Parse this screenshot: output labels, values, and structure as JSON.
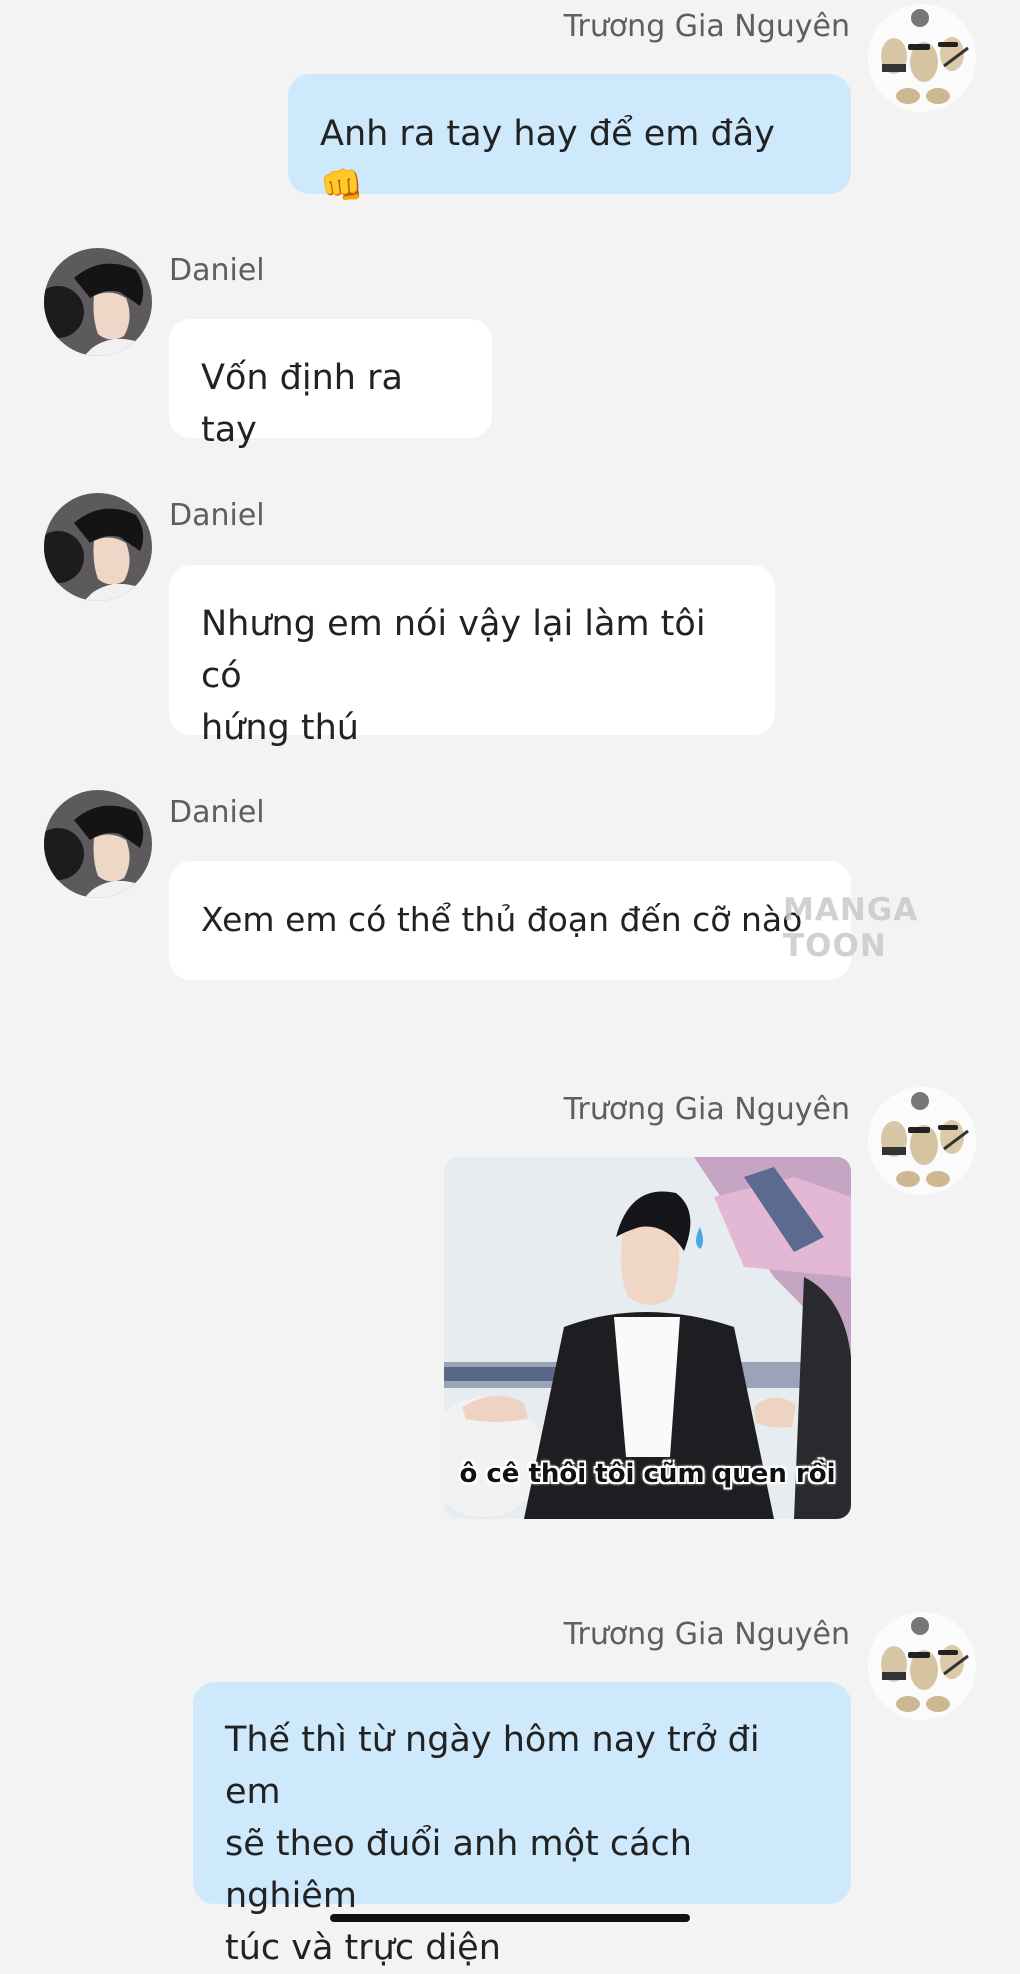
{
  "sender_names": {
    "user": "Trương Gia Nguyên",
    "other": "Daniel"
  },
  "messages": [
    {
      "sender": "Trương Gia Nguyên",
      "text": "Anh ra tay hay để em đây 👊"
    },
    {
      "sender": "Daniel",
      "text": "Vốn định ra tay"
    },
    {
      "sender": "Daniel",
      "text": "Nhưng em nói vậy lại làm tôi có",
      "text2": "hứng thú"
    },
    {
      "sender": "Daniel",
      "text": "Xem em có thể thủ đoạn đến cỡ nào"
    },
    {
      "sender": "Trương Gia Nguyên",
      "image_caption": "ô cê thôi tôi cũm quen rồi"
    },
    {
      "sender": "Trương Gia Nguyên",
      "text": "Thế thì từ ngày hôm nay trở đi em",
      "text2": "sẽ theo đuổi anh một cách nghiêm",
      "text3": "túc và trực diện"
    }
  ],
  "watermark": "MANGA TOON",
  "colors": {
    "background": "#f3f3f4",
    "bubble_user": "#cde9fb",
    "bubble_other": "#ffffff",
    "name_text": "#5e5e5e"
  }
}
